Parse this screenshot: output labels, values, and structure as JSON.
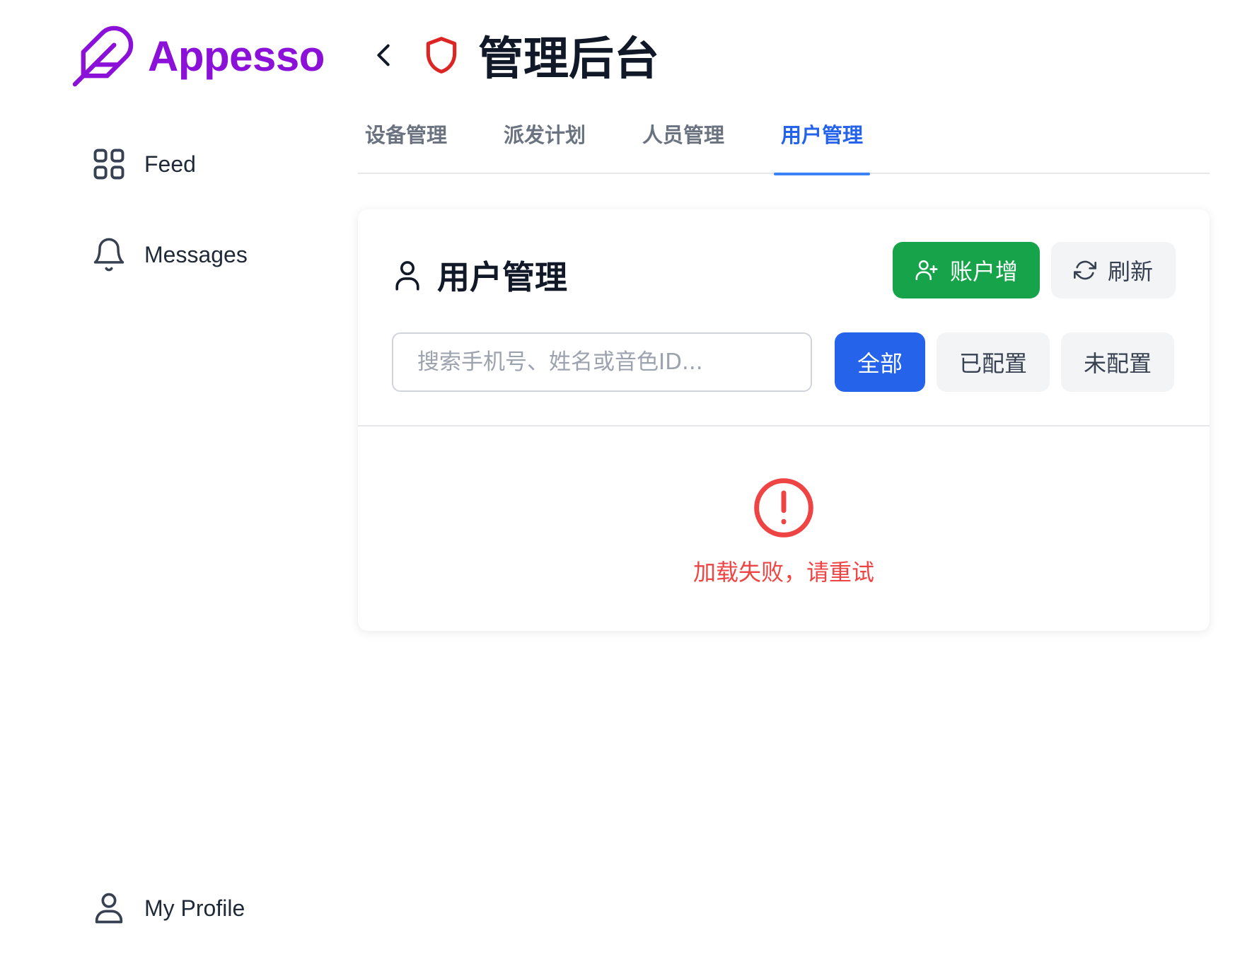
{
  "brand": {
    "name": "Appesso",
    "color": "#8b10d8"
  },
  "sidebar": {
    "items": [
      {
        "label": "Feed",
        "icon": "grid-icon"
      },
      {
        "label": "Messages",
        "icon": "bell-icon"
      },
      {
        "label": "My Profile",
        "icon": "user-icon"
      }
    ]
  },
  "header": {
    "title": "管理后台",
    "back_icon": "chevron-left-icon",
    "title_icon": "shield-icon"
  },
  "tabs": [
    {
      "label": "设备管理",
      "active": false
    },
    {
      "label": "派发计划",
      "active": false
    },
    {
      "label": "人员管理",
      "active": false
    },
    {
      "label": "用户管理",
      "active": true
    }
  ],
  "card": {
    "title": "用户管理",
    "title_icon": "user-icon",
    "add_button": {
      "label": "账户增",
      "icon": "user-plus-icon"
    },
    "refresh_button": {
      "label": "刷新",
      "icon": "refresh-icon"
    },
    "search": {
      "placeholder": "搜索手机号、姓名或音色ID...",
      "value": ""
    },
    "filters": [
      {
        "label": "全部",
        "active": true
      },
      {
        "label": "已配置",
        "active": false
      },
      {
        "label": "未配置",
        "active": false
      }
    ],
    "error": {
      "message": "加载失败，请重试",
      "icon": "alert-circle-icon"
    }
  },
  "colors": {
    "active_tab": "#2563eb",
    "add_button": "#16a34a",
    "filter_active": "#2563eb",
    "error": "#ef4444",
    "shield": "#dc2626"
  }
}
